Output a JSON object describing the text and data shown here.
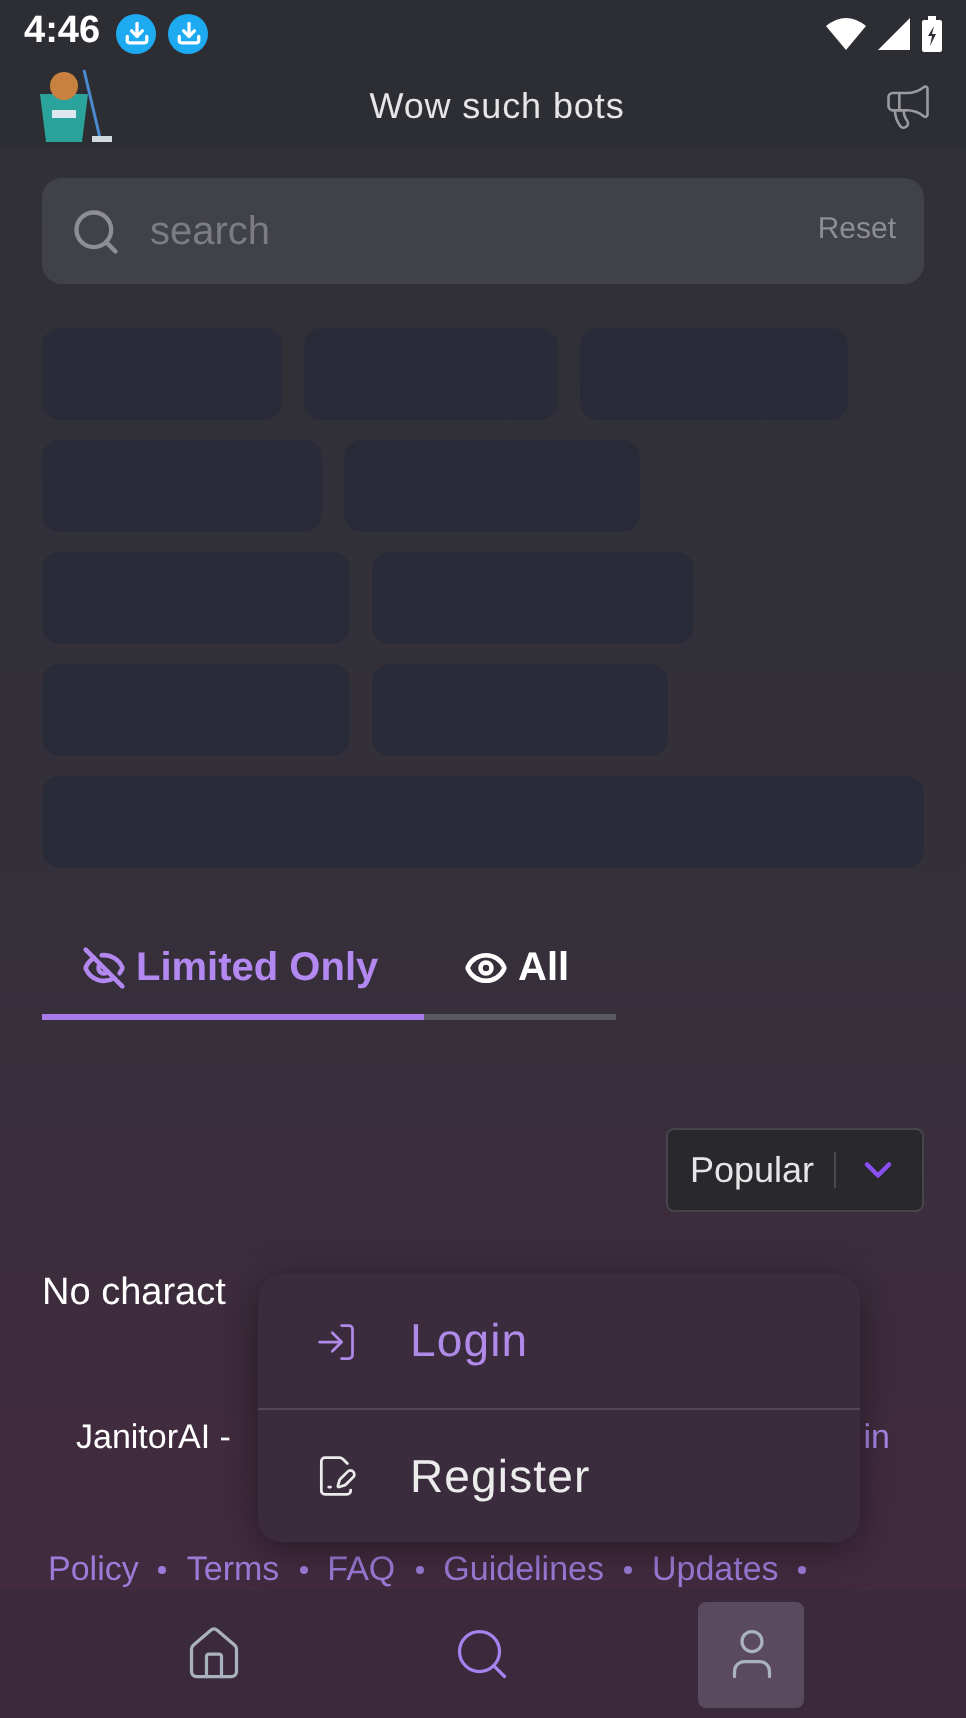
{
  "status_bar": {
    "time": "4:46",
    "notifications": [
      {
        "kind": "download"
      },
      {
        "kind": "download"
      }
    ]
  },
  "header": {
    "title": "Wow such bots"
  },
  "search": {
    "placeholder": "search",
    "reset": "Reset"
  },
  "tabs": [
    {
      "label": "Limited Only",
      "kind": "limited",
      "selected": true
    },
    {
      "label": "All",
      "kind": "all",
      "selected": false
    }
  ],
  "sort": {
    "value": "Popular"
  },
  "empty_message": "No charact",
  "footer": {
    "left": "JanitorAI -",
    "right": "in",
    "links": [
      "Policy",
      "Terms",
      "FAQ",
      "Guidelines",
      "Updates"
    ]
  },
  "menu": {
    "open": true,
    "items": [
      {
        "label": "Login",
        "kind": "login"
      },
      {
        "label": "Register",
        "kind": "register"
      }
    ]
  },
  "nav": [
    {
      "kind": "home",
      "selected": false
    },
    {
      "kind": "search",
      "selected": true
    },
    {
      "kind": "account",
      "selected": false
    }
  ]
}
